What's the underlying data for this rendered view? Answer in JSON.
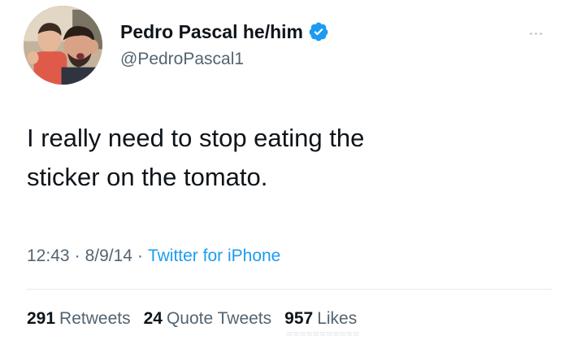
{
  "author": {
    "display_name": "Pedro Pascal he/him",
    "handle": "@PedroPascal1",
    "verified": true
  },
  "tweet": {
    "text": "I really need to stop eating the\nsticker on the tomato.",
    "time": "12:43",
    "date": "8/9/14",
    "source": "Twitter for iPhone"
  },
  "stats": {
    "retweets_count": "291",
    "retweets_label": "Retweets",
    "quote_tweets_count": "24",
    "quote_tweets_label": "Quote Tweets",
    "likes_count": "957",
    "likes_label": "Likes"
  },
  "icons": {
    "verified": "verified-badge-icon",
    "more": "more-dots-icon"
  },
  "colors": {
    "verified_blue": "#1d9bf0",
    "secondary_text": "#536471",
    "primary_text": "#0f1419",
    "link": "#1d9bf0"
  }
}
